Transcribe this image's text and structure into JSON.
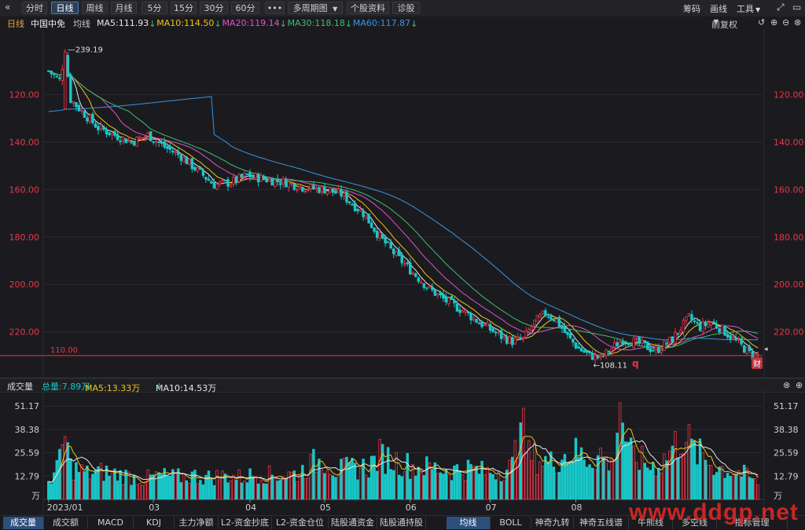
{
  "toolbar": {
    "back_icon": "double-chevron-left-icon",
    "periods": [
      "分时",
      "日线",
      "周线",
      "月线",
      "5分",
      "15分",
      "30分",
      "60分"
    ],
    "active_period": "日线",
    "more_label": "•••",
    "multi_period_label": "多周期图",
    "stock_info_label": "个股资料",
    "diagnose_label": "诊股",
    "right_tools": [
      "筹码",
      "画线",
      "工具"
    ],
    "right_icons": [
      "expand-icon",
      "window-icon"
    ]
  },
  "main_chart": {
    "period_label": "日线",
    "stock_name": "中国中免",
    "indicator_label": "均线",
    "ma_labels": [
      {
        "text": "MA5:111.93",
        "color": "#e8e8e8"
      },
      {
        "text": "MA10:114.50",
        "color": "#f2c21a"
      },
      {
        "text": "MA20:119.14",
        "color": "#e052c8"
      },
      {
        "text": "MA30:118.18",
        "color": "#3fbf6a"
      },
      {
        "text": "MA60:117.87",
        "color": "#3a95e0"
      }
    ],
    "down_arrow": "↓",
    "adjust_label": "前复权",
    "adjust_icons": [
      "chevron-down-icon",
      "undo-icon",
      "plus-icon",
      "minus-icon",
      "close-icon"
    ],
    "y_ticks": [
      "220.00",
      "200.00",
      "180.00",
      "160.00",
      "140.00",
      "120.00"
    ],
    "high_label": "239.19",
    "low_label": "108.11",
    "ref_line_label": "110.00",
    "marker_q": "q",
    "marker_cai": "财",
    "colors": {
      "up": "#e8364a",
      "down": "#19c7c7",
      "ref": "#e8364a",
      "grid": "#2a2a30"
    }
  },
  "volume_panel": {
    "title": "成交量",
    "total_label": "总量:7.89万",
    "ma5_label": "MA5:13.33万",
    "ma10_label": "MA10:14.53万",
    "y_ticks": [
      "51.17",
      "38.38",
      "25.59",
      "12.79"
    ],
    "unit": "万",
    "x_labels": [
      "2023/01",
      "03",
      "04",
      "05",
      "06",
      "07",
      "08"
    ],
    "close_icon": "close-icon",
    "plus_icon": "plus-icon"
  },
  "bottom_tabs": {
    "left": [
      "成交量",
      "成交额",
      "MACD",
      "KDJ",
      "主力净额",
      "L2-资金抄底",
      "L2-资金仓位",
      "陆股通资金",
      "陆股通持股"
    ],
    "left_active": "成交量",
    "right": [
      "均线",
      "BOLL",
      "神奇九转",
      "神奇五线谱",
      "牛熊线",
      "多空线",
      "指标管理"
    ],
    "right_active": "均线"
  },
  "watermark": "www.ddgp.net",
  "chart_data": [
    {
      "type": "candlestick",
      "title": "",
      "ylim": [
        102,
        245
      ],
      "y_ticks": [
        120,
        140,
        160,
        180,
        200,
        220
      ],
      "x_labels": [
        "2023/01",
        "03",
        "04",
        "05",
        "06",
        "07",
        "08"
      ],
      "reference_line": 110.0,
      "annotations": [
        {
          "label": "239.19",
          "value": 239.19
        },
        {
          "label": "108.11",
          "value": 108.11
        }
      ],
      "ma_final": {
        "MA5": 111.93,
        "MA10": 114.5,
        "MA20": 119.14,
        "MA30": 118.18,
        "MA60": 117.87
      },
      "close_path": [
        [
          0,
          230
        ],
        [
          4,
          226
        ],
        [
          6,
          238
        ],
        [
          8,
          218
        ],
        [
          12,
          213
        ],
        [
          18,
          206
        ],
        [
          24,
          203
        ],
        [
          30,
          200
        ],
        [
          36,
          203
        ],
        [
          42,
          198
        ],
        [
          48,
          194
        ],
        [
          54,
          188
        ],
        [
          60,
          182
        ],
        [
          66,
          183
        ],
        [
          72,
          186
        ],
        [
          80,
          184
        ],
        [
          86,
          183
        ],
        [
          92,
          181
        ],
        [
          100,
          180
        ],
        [
          106,
          178
        ],
        [
          114,
          170
        ],
        [
          120,
          160
        ],
        [
          126,
          152
        ],
        [
          132,
          145
        ],
        [
          138,
          138
        ],
        [
          144,
          133
        ],
        [
          150,
          129
        ],
        [
          156,
          124
        ],
        [
          160,
          121
        ],
        [
          164,
          118
        ],
        [
          168,
          116
        ],
        [
          172,
          117
        ],
        [
          176,
          124
        ],
        [
          180,
          128
        ],
        [
          184,
          125
        ],
        [
          188,
          118
        ],
        [
          192,
          113
        ],
        [
          196,
          110
        ],
        [
          200,
          109
        ],
        [
          204,
          113
        ],
        [
          208,
          117
        ],
        [
          214,
          115
        ],
        [
          220,
          112
        ],
        [
          226,
          117
        ],
        [
          232,
          126
        ],
        [
          236,
          122
        ],
        [
          240,
          124
        ],
        [
          244,
          121
        ],
        [
          248,
          117
        ],
        [
          252,
          113
        ],
        [
          255,
          110
        ],
        [
          257,
          110
        ]
      ],
      "grid": true
    },
    {
      "type": "bar",
      "title": "成交量",
      "ylabel": "万",
      "ylim": [
        0,
        56
      ],
      "y_ticks": [
        12.79,
        25.59,
        38.38,
        51.17
      ],
      "series": [
        {
          "name": "成交量"
        },
        {
          "name": "MA5",
          "last": 13.33
        },
        {
          "name": "MA10",
          "last": 14.53
        }
      ],
      "last_value": 7.89,
      "volume_path": [
        [
          0,
          10
        ],
        [
          4,
          20
        ],
        [
          6,
          35
        ],
        [
          8,
          18
        ],
        [
          14,
          14
        ],
        [
          20,
          15
        ],
        [
          28,
          13
        ],
        [
          34,
          11
        ],
        [
          40,
          13
        ],
        [
          46,
          12
        ],
        [
          52,
          13
        ],
        [
          58,
          12
        ],
        [
          64,
          13
        ],
        [
          70,
          12
        ],
        [
          76,
          14
        ],
        [
          82,
          13
        ],
        [
          90,
          14
        ],
        [
          96,
          20
        ],
        [
          100,
          22
        ],
        [
          104,
          16
        ],
        [
          110,
          17
        ],
        [
          116,
          18
        ],
        [
          120,
          24
        ],
        [
          126,
          21
        ],
        [
          132,
          18
        ],
        [
          140,
          17
        ],
        [
          146,
          16
        ],
        [
          152,
          17
        ],
        [
          158,
          15
        ],
        [
          164,
          16
        ],
        [
          168,
          18
        ],
        [
          171,
          42
        ],
        [
          174,
          24
        ],
        [
          178,
          22
        ],
        [
          182,
          20
        ],
        [
          186,
          24
        ],
        [
          190,
          26
        ],
        [
          196,
          22
        ],
        [
          200,
          25
        ],
        [
          204,
          18
        ],
        [
          207,
          53
        ],
        [
          210,
          25
        ],
        [
          214,
          22
        ],
        [
          218,
          18
        ],
        [
          222,
          20
        ],
        [
          226,
          28
        ],
        [
          230,
          36
        ],
        [
          234,
          26
        ],
        [
          238,
          22
        ],
        [
          242,
          18
        ],
        [
          246,
          16
        ],
        [
          250,
          15
        ],
        [
          254,
          12
        ],
        [
          257,
          8
        ]
      ]
    }
  ]
}
